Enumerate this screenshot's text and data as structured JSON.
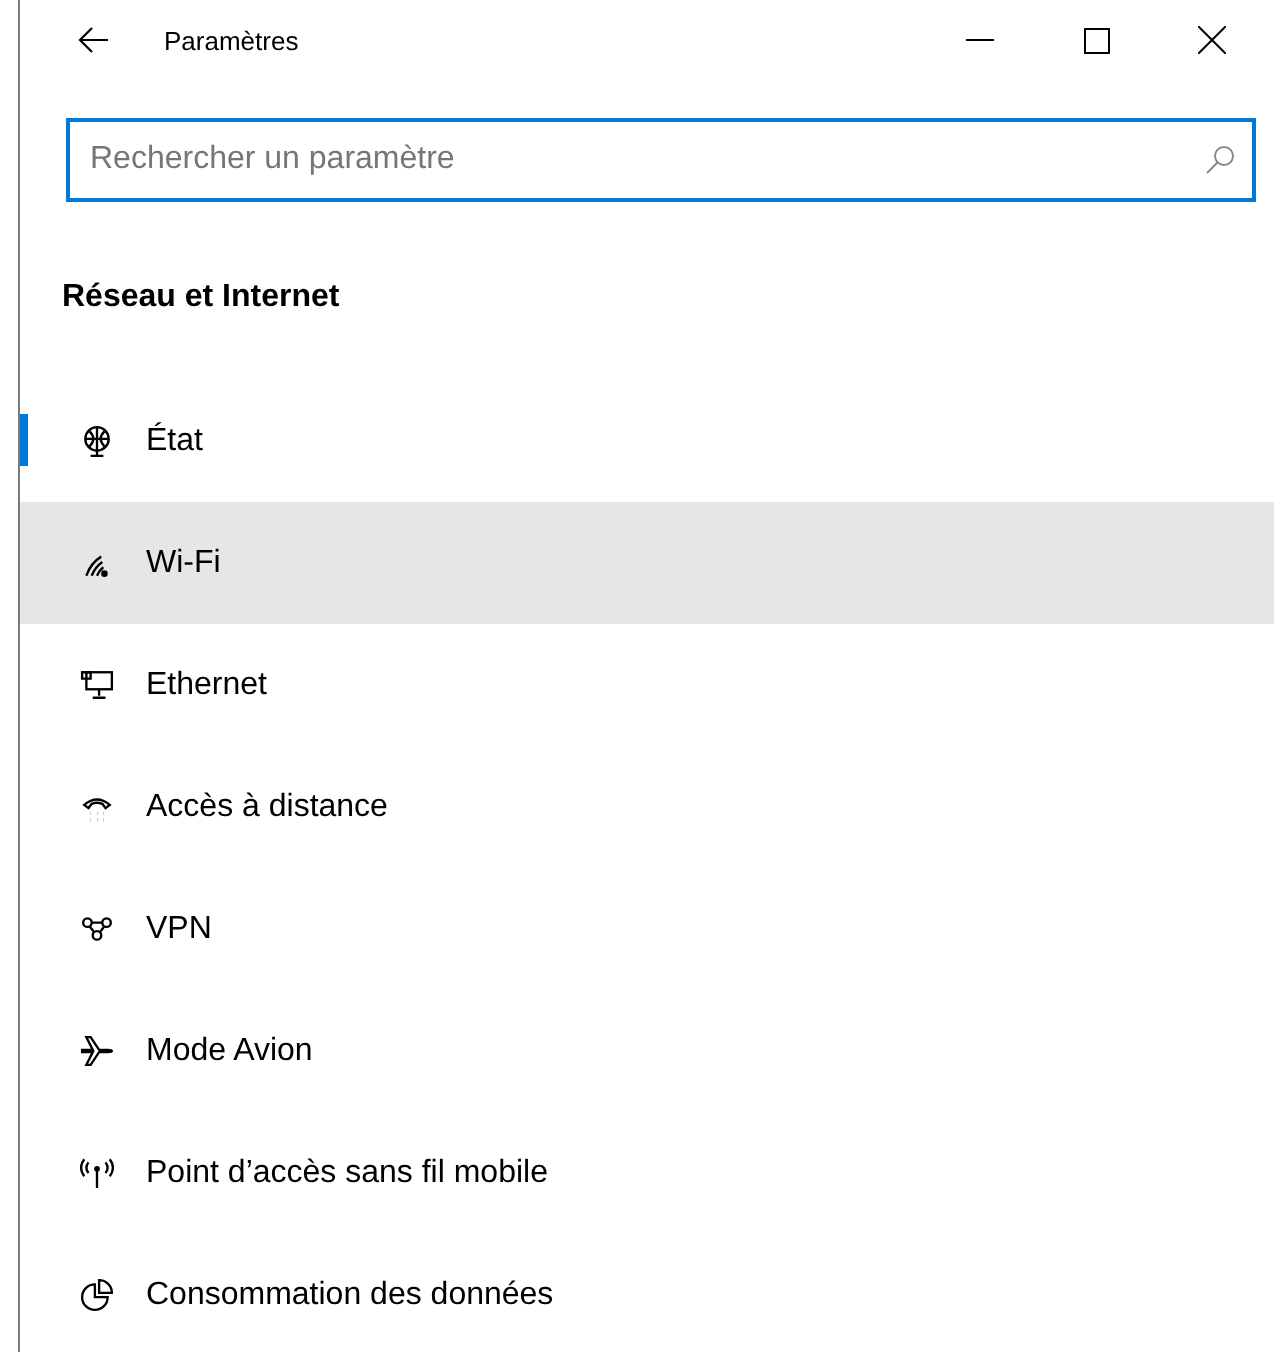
{
  "window": {
    "title": "Paramètres"
  },
  "search": {
    "placeholder": "Rechercher un paramètre"
  },
  "section": {
    "title": "Réseau et Internet"
  },
  "nav": [
    {
      "label": "État",
      "selected": true,
      "hovered": false
    },
    {
      "label": "Wi-Fi",
      "selected": false,
      "hovered": true
    },
    {
      "label": "Ethernet",
      "selected": false,
      "hovered": false
    },
    {
      "label": "Accès à distance",
      "selected": false,
      "hovered": false
    },
    {
      "label": "VPN",
      "selected": false,
      "hovered": false
    },
    {
      "label": "Mode Avion",
      "selected": false,
      "hovered": false
    },
    {
      "label": "Point d’accès sans fil mobile",
      "selected": false,
      "hovered": false
    },
    {
      "label": "Consommation des données",
      "selected": false,
      "hovered": false
    }
  ]
}
